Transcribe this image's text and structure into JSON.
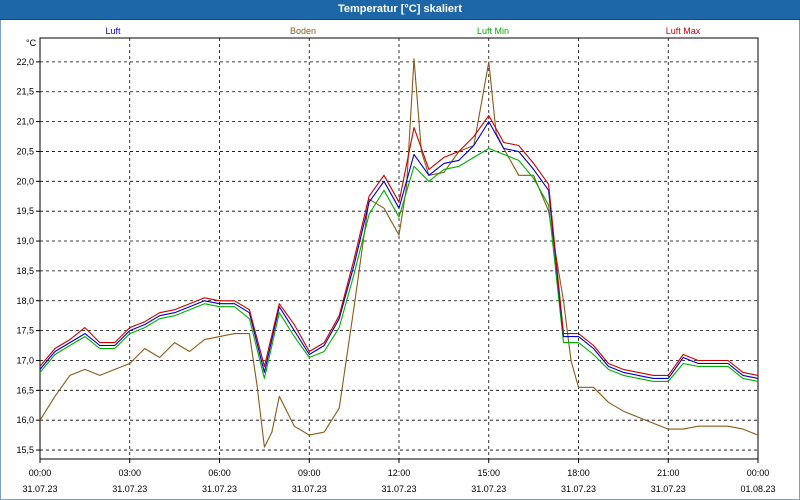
{
  "window": {
    "title": "Temperatur [°C] skaliert"
  },
  "colors": {
    "titlebar": "#1d66a8",
    "luft": "#0000cc",
    "boden": "#8b5a1a",
    "luft_min": "#00b000",
    "luft_max": "#cc0000"
  },
  "chart_data": {
    "type": "line",
    "title": "Temperatur [°C] skaliert",
    "ylabel": "°C",
    "xlabel": "",
    "ylim": [
      15.35,
      22.4
    ],
    "xlim": [
      0,
      24
    ],
    "grid": true,
    "legend_placement": "top",
    "yticks": [
      "15,5",
      "16,0",
      "16,5",
      "17,0",
      "17,5",
      "18,0",
      "18,5",
      "19,0",
      "19,5",
      "20,0",
      "20,5",
      "21,0",
      "21,5",
      "22,0"
    ],
    "xticks": [
      {
        "time": "00:00",
        "date": "31.07.23"
      },
      {
        "time": "03:00",
        "date": "31.07.23"
      },
      {
        "time": "06:00",
        "date": "31.07.23"
      },
      {
        "time": "09:00",
        "date": "31.07.23"
      },
      {
        "time": "12:00",
        "date": "31.07.23"
      },
      {
        "time": "15:00",
        "date": "31.07.23"
      },
      {
        "time": "18:00",
        "date": "31.07.23"
      },
      {
        "time": "21:00",
        "date": "31.07.23"
      },
      {
        "time": "00:00",
        "date": "01.08.23"
      }
    ],
    "series": [
      {
        "name": "Luft",
        "color": "#0000cc",
        "x": [
          0,
          0.5,
          1,
          1.5,
          2,
          2.5,
          3,
          3.5,
          4,
          4.5,
          5,
          5.5,
          6,
          6.5,
          7,
          7.5,
          8,
          8.5,
          9,
          9.5,
          10,
          10.5,
          11,
          11.5,
          12,
          12.5,
          13,
          13.5,
          14,
          14.5,
          15,
          15.5,
          16,
          16.5,
          17,
          17.5,
          18,
          18.5,
          19,
          19.5,
          20,
          20.5,
          21,
          21.5,
          22,
          22.5,
          23,
          23.5,
          24
        ],
        "y": [
          16.85,
          17.15,
          17.3,
          17.45,
          17.25,
          17.25,
          17.5,
          17.6,
          17.75,
          17.8,
          17.9,
          18.0,
          17.95,
          17.95,
          17.8,
          16.8,
          17.9,
          17.5,
          17.1,
          17.25,
          17.7,
          18.6,
          19.65,
          20.0,
          19.55,
          20.45,
          20.1,
          20.3,
          20.35,
          20.6,
          21.0,
          20.55,
          20.5,
          20.2,
          19.85,
          17.4,
          17.4,
          17.2,
          16.9,
          16.8,
          16.75,
          16.7,
          16.7,
          17.05,
          16.95,
          16.95,
          16.95,
          16.75,
          16.7
        ]
      },
      {
        "name": "Boden",
        "color": "#8b5a1a",
        "x": [
          0,
          0.5,
          1,
          1.5,
          2,
          2.5,
          3,
          3.5,
          4,
          4.5,
          5,
          5.5,
          6,
          6.5,
          7,
          7.25,
          7.5,
          7.75,
          8,
          8.5,
          9,
          9.5,
          10,
          10.5,
          11,
          11.5,
          12,
          12.25,
          12.5,
          12.75,
          13,
          13.5,
          14,
          14.5,
          15,
          15.25,
          15.5,
          16,
          16.5,
          17,
          17.5,
          17.75,
          18,
          18.5,
          19,
          19.5,
          20,
          20.5,
          21,
          21.5,
          22,
          22.5,
          23,
          23.5,
          24
        ],
        "y": [
          16.0,
          16.4,
          16.75,
          16.85,
          16.75,
          16.85,
          16.95,
          17.2,
          17.05,
          17.3,
          17.15,
          17.35,
          17.4,
          17.45,
          17.45,
          16.6,
          15.55,
          15.8,
          16.4,
          15.9,
          15.75,
          15.8,
          16.2,
          17.9,
          19.7,
          19.55,
          19.1,
          19.9,
          22.05,
          20.5,
          20.1,
          20.15,
          20.5,
          20.6,
          22.0,
          20.8,
          20.55,
          20.1,
          20.1,
          19.5,
          18.0,
          17.0,
          16.55,
          16.55,
          16.3,
          16.15,
          16.05,
          15.95,
          15.85,
          15.85,
          15.9,
          15.9,
          15.9,
          15.85,
          15.75
        ]
      },
      {
        "name": "Luft Min",
        "color": "#00b000",
        "x": [
          0,
          0.5,
          1,
          1.5,
          2,
          2.5,
          3,
          3.5,
          4,
          4.5,
          5,
          5.5,
          6,
          6.5,
          7,
          7.5,
          8,
          8.5,
          9,
          9.5,
          10,
          10.5,
          11,
          11.5,
          12,
          12.5,
          13,
          13.5,
          14,
          14.5,
          15,
          15.5,
          16,
          16.5,
          17,
          17.5,
          18,
          18.5,
          19,
          19.5,
          20,
          20.5,
          21,
          21.5,
          22,
          22.5,
          23,
          23.5,
          24
        ],
        "y": [
          16.8,
          17.1,
          17.25,
          17.4,
          17.2,
          17.2,
          17.45,
          17.55,
          17.7,
          17.75,
          17.85,
          17.95,
          17.9,
          17.9,
          17.7,
          16.7,
          17.8,
          17.4,
          17.05,
          17.15,
          17.55,
          18.45,
          19.45,
          19.85,
          19.4,
          20.25,
          20.0,
          20.2,
          20.25,
          20.4,
          20.55,
          20.45,
          20.35,
          20.05,
          19.6,
          17.3,
          17.3,
          17.1,
          16.85,
          16.75,
          16.7,
          16.65,
          16.65,
          16.95,
          16.9,
          16.9,
          16.9,
          16.7,
          16.65
        ]
      },
      {
        "name": "Luft Max",
        "color": "#cc0000",
        "x": [
          0,
          0.5,
          1,
          1.5,
          2,
          2.5,
          3,
          3.5,
          4,
          4.5,
          5,
          5.5,
          6,
          6.5,
          7,
          7.5,
          8,
          8.5,
          9,
          9.5,
          10,
          10.5,
          11,
          11.5,
          12,
          12.5,
          13,
          13.5,
          14,
          14.5,
          15,
          15.5,
          16,
          16.5,
          17,
          17.5,
          18,
          18.5,
          19,
          19.5,
          20,
          20.5,
          21,
          21.5,
          22,
          22.5,
          23,
          23.5,
          24
        ],
        "y": [
          16.9,
          17.2,
          17.35,
          17.55,
          17.3,
          17.3,
          17.55,
          17.65,
          17.8,
          17.85,
          17.95,
          18.05,
          18.0,
          18.0,
          17.85,
          16.9,
          17.95,
          17.6,
          17.15,
          17.3,
          17.75,
          18.7,
          19.75,
          20.1,
          19.65,
          20.9,
          20.2,
          20.4,
          20.5,
          20.75,
          21.1,
          20.65,
          20.6,
          20.3,
          19.95,
          17.45,
          17.45,
          17.25,
          16.95,
          16.85,
          16.8,
          16.75,
          16.75,
          17.1,
          17.0,
          17.0,
          17.0,
          16.8,
          16.75
        ]
      }
    ]
  }
}
